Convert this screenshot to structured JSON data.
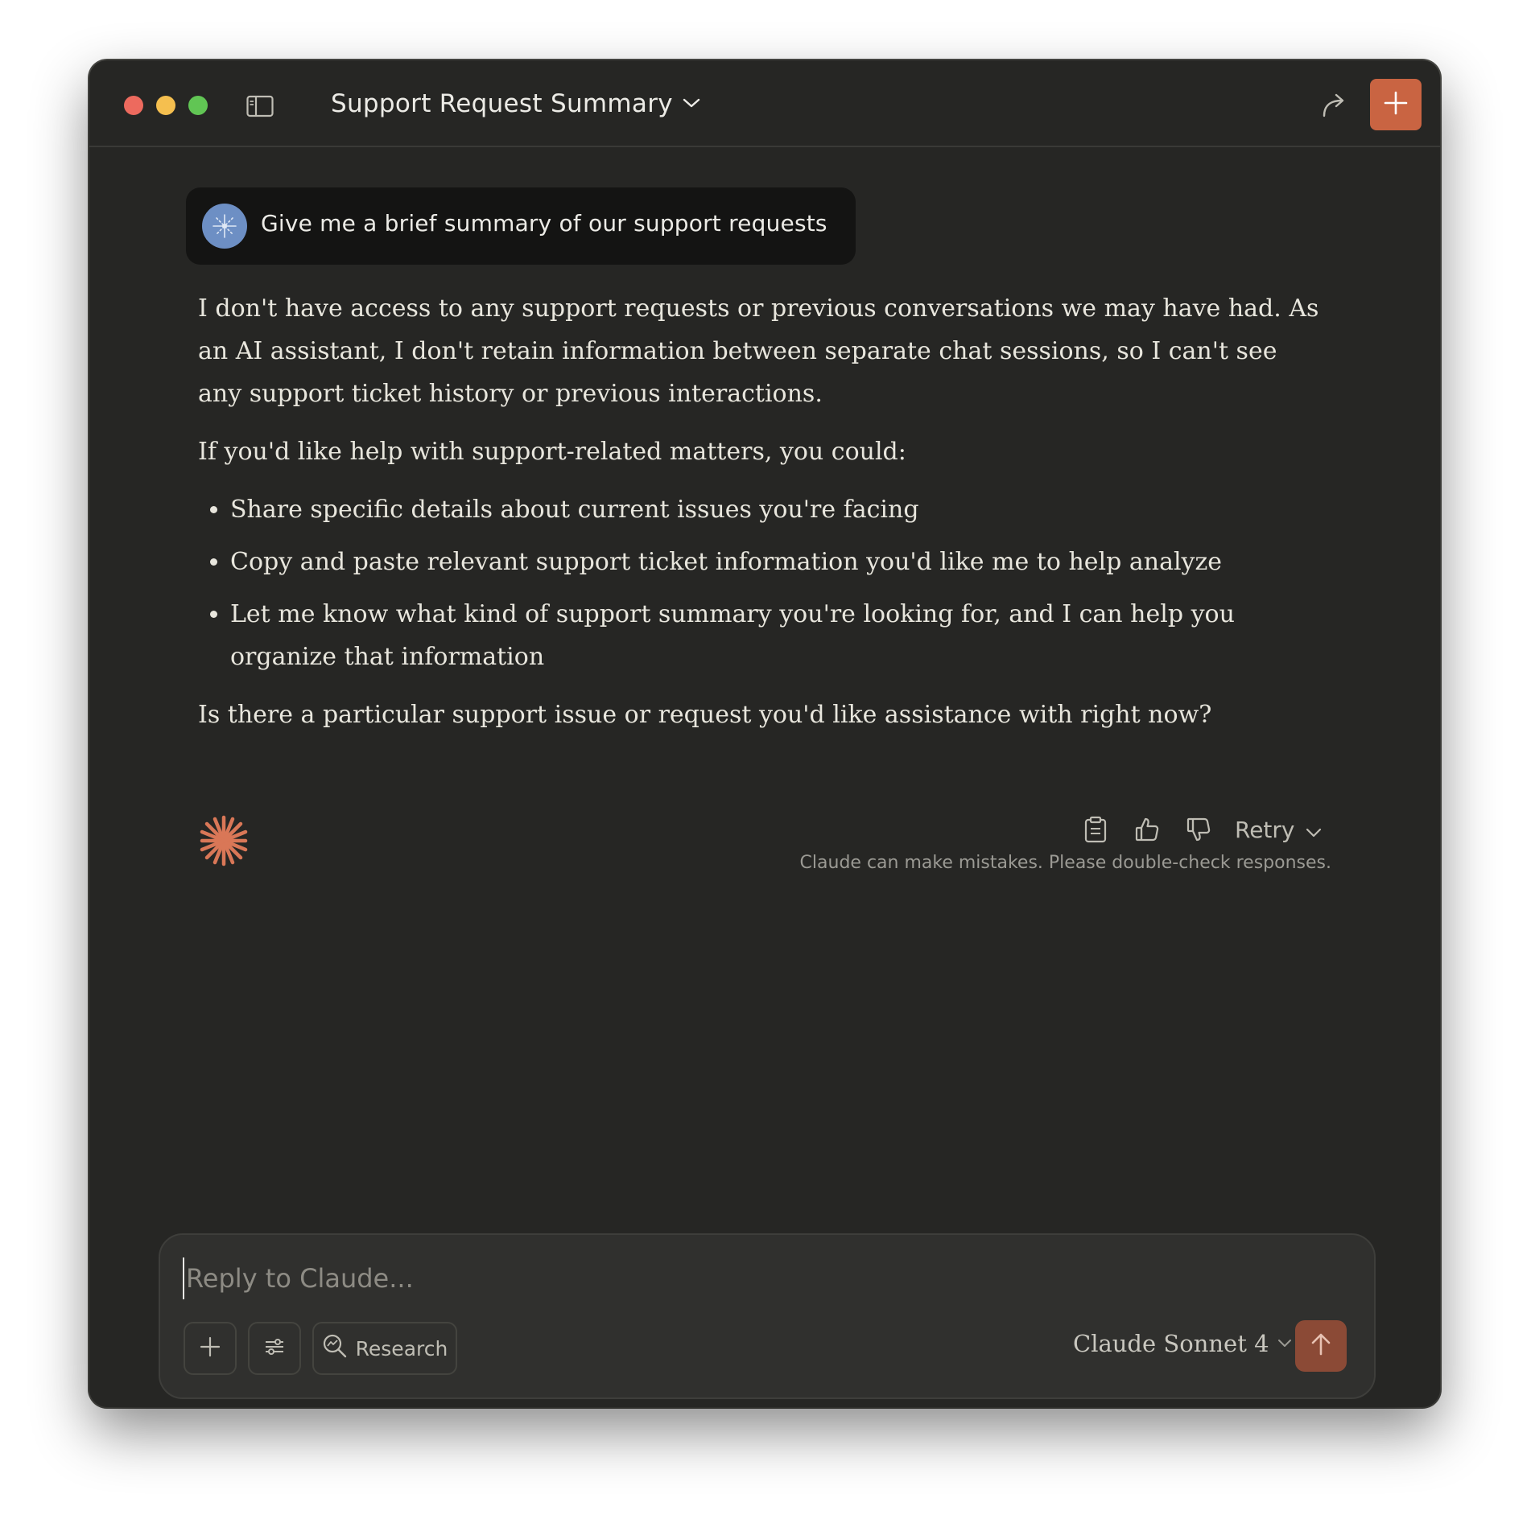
{
  "window": {
    "title": "Support Request Summary",
    "accent_color": "#c96442",
    "background_color": "#262624"
  },
  "toolbar": {
    "sidebar_icon": "sidebar-toggle-icon",
    "share_icon": "share-arrow-icon",
    "new_chat_icon": "plus-icon"
  },
  "conversation": {
    "user_message": "Give me a brief summary of our support requests",
    "response": {
      "paragraph_1": "I don't have access to any support requests or previous conversations we may have had. As an AI assistant, I don't retain information between separate chat sessions, so I can't see any support ticket history or previous interactions.",
      "paragraph_2": "If you'd like help with support-related matters, you could:",
      "bullets": [
        "Share specific details about current issues you're facing",
        "Copy and paste relevant support ticket information you'd like me to help analyze",
        "Let me know what kind of support summary you're looking for, and I can help you organize that information"
      ],
      "paragraph_3": "Is there a particular support issue or request you'd like assistance with right now?"
    },
    "actions": {
      "copy_icon": "clipboard-icon",
      "thumbs_up_icon": "thumbs-up-icon",
      "thumbs_down_icon": "thumbs-down-icon",
      "retry_label": "Retry"
    },
    "disclaimer": "Claude can make mistakes. Please double-check responses."
  },
  "composer": {
    "placeholder": "Reply to Claude...",
    "value": "",
    "research_label": "Research",
    "model_name": "Claude Sonnet 4"
  }
}
